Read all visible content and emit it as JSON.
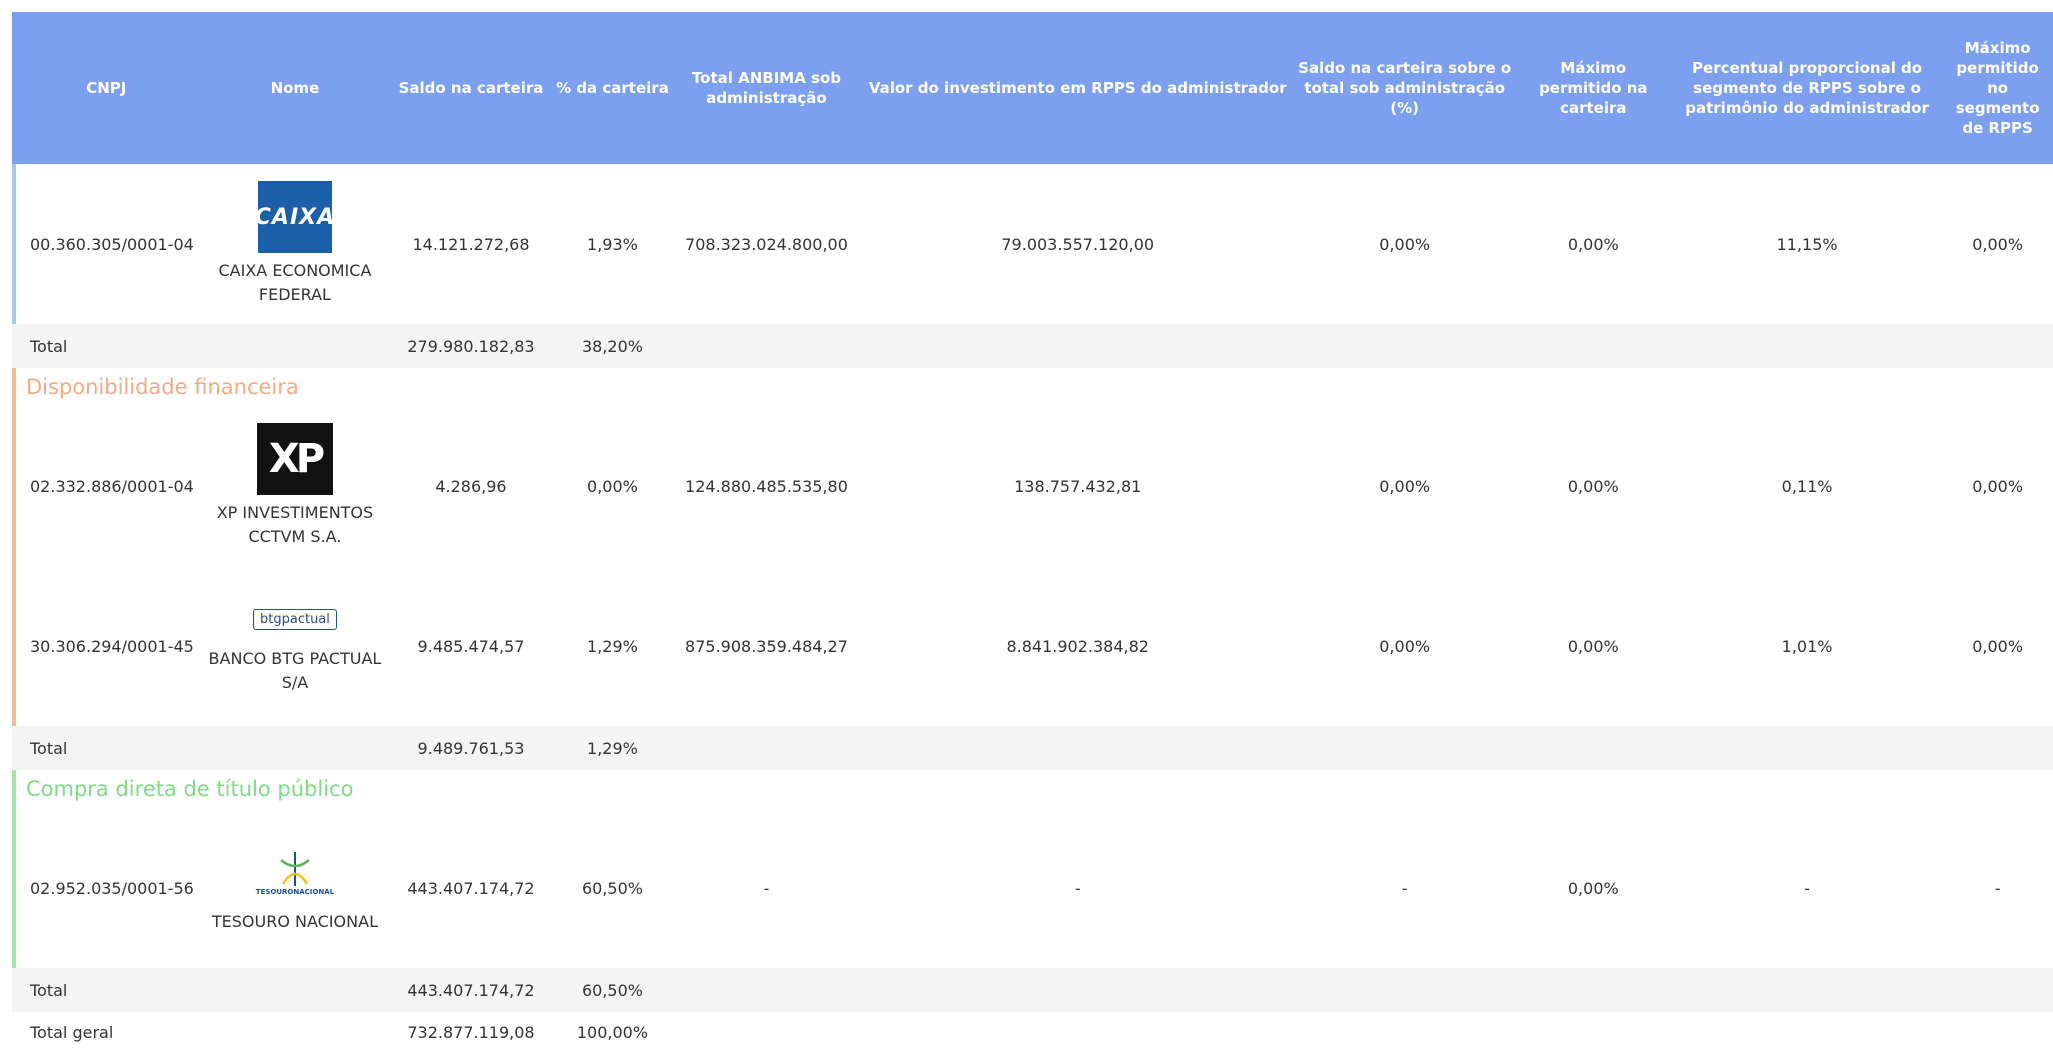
{
  "header": {
    "cnpj": "CNPJ",
    "nome": "Nome",
    "saldo": "Saldo na carteira",
    "pct": "% da carteira",
    "anbima": "Total ANBIMA sob administração",
    "valor_rpps": "Valor do investimento em RPPS do administrador",
    "saldo_sobre": "Saldo na carteira sobre o total sob administração (%)",
    "max_carteira": "Máximo permitido na carteira",
    "percentual": "Percentual proporcional do segmento de RPPS sobre o patrimônio do administrador",
    "max_segmento": "Máximo permitido no segmento de RPPS"
  },
  "rows": {
    "caixa": {
      "cnpj": "00.360.305/0001-04",
      "logo": "CAIXA",
      "nome": "CAIXA ECONOMICA FEDERAL",
      "saldo": "14.121.272,68",
      "pct": "1,93%",
      "anbima": "708.323.024.800,00",
      "valor_rpps": "79.003.557.120,00",
      "saldo_sobre": "0,00%",
      "max_carteira": "0,00%",
      "percentual": "11,15%",
      "max_segmento": "0,00%"
    },
    "total1": {
      "label": "Total",
      "saldo": "279.980.182,83",
      "pct": "38,20%"
    },
    "seg_disp": "Disponibilidade financeira",
    "xp": {
      "cnpj": "02.332.886/0001-04",
      "logo": "XP",
      "nome": "XP INVESTIMENTOS CCTVM S.A.",
      "saldo": "4.286,96",
      "pct": "0,00%",
      "anbima": "124.880.485.535,80",
      "valor_rpps": "138.757.432,81",
      "saldo_sobre": "0,00%",
      "max_carteira": "0,00%",
      "percentual": "0,11%",
      "max_segmento": "0,00%"
    },
    "btg": {
      "cnpj": "30.306.294/0001-45",
      "logo": "btgpactual",
      "nome": "BANCO BTG PACTUAL S/A",
      "saldo": "9.485.474,57",
      "pct": "1,29%",
      "anbima": "875.908.359.484,27",
      "valor_rpps": "8.841.902.384,82",
      "saldo_sobre": "0,00%",
      "max_carteira": "0,00%",
      "percentual": "1,01%",
      "max_segmento": "0,00%"
    },
    "total2": {
      "label": "Total",
      "saldo": "9.489.761,53",
      "pct": "1,29%"
    },
    "seg_compra": "Compra direta de título público",
    "tesouro": {
      "cnpj": "02.952.035/0001-56",
      "logo": "TESOURONACIONAL",
      "nome": "TESOURO NACIONAL",
      "saldo": "443.407.174,72",
      "pct": "60,50%",
      "anbima": "-",
      "valor_rpps": "-",
      "saldo_sobre": "-",
      "max_carteira": "0,00%",
      "percentual": "-",
      "max_segmento": "-"
    },
    "total3": {
      "label": "Total",
      "saldo": "443.407.174,72",
      "pct": "60,50%"
    },
    "grand": {
      "label": "Total geral",
      "saldo": "732.877.119,08",
      "pct": "100,00%"
    }
  }
}
